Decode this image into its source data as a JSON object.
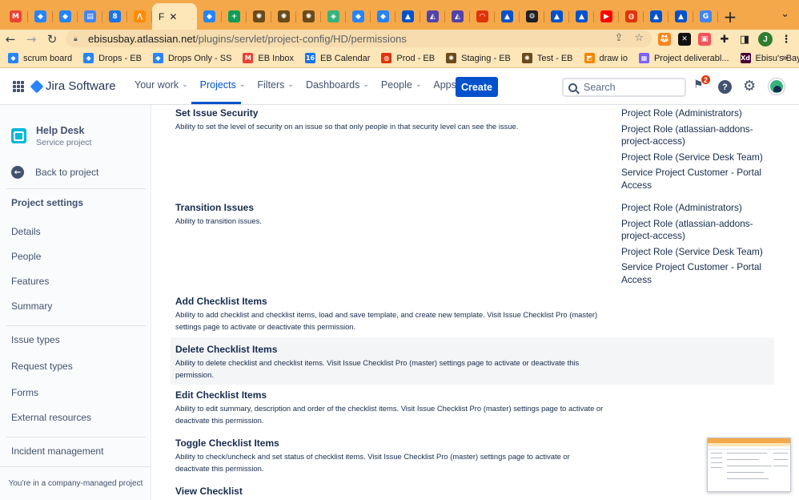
{
  "browser": {
    "tabs": [
      {
        "icon": "gmail-icon",
        "glyph": "M",
        "color": "#ea4335"
      },
      {
        "icon": "jira-icon",
        "glyph": "◆",
        "color": "#2684ff"
      },
      {
        "icon": "jira-icon",
        "glyph": "◆",
        "color": "#2684ff"
      },
      {
        "icon": "book-icon",
        "glyph": "▤",
        "color": "#4285f4"
      },
      {
        "icon": "calendar-icon",
        "glyph": "8",
        "color": "#1a73e8"
      },
      {
        "icon": "pipeline-icon",
        "glyph": "⋀",
        "color": "#ff8b00"
      }
    ],
    "active_tab": {
      "label": "F",
      "close": "✕"
    },
    "tabs_after": [
      {
        "icon": "jira-icon",
        "glyph": "◆",
        "color": "#2684ff"
      },
      {
        "icon": "sheets-icon",
        "glyph": "+",
        "color": "#0f9d58"
      },
      {
        "icon": "bug-icon",
        "glyph": "✺",
        "color": "#6b4a1a"
      },
      {
        "icon": "bug-icon",
        "glyph": "✺",
        "color": "#6b4a1a"
      },
      {
        "icon": "bug-icon",
        "glyph": "✺",
        "color": "#6b4a1a"
      },
      {
        "icon": "cube-icon",
        "glyph": "◈",
        "color": "#36b37e"
      },
      {
        "icon": "jira-icon",
        "glyph": "◆",
        "color": "#2684ff"
      },
      {
        "icon": "jira-icon",
        "glyph": "◆",
        "color": "#2684ff"
      },
      {
        "icon": "atlassian-icon",
        "glyph": "▲",
        "color": "#0052cc"
      },
      {
        "icon": "rocket-icon",
        "glyph": "◭",
        "color": "#5243aa"
      },
      {
        "icon": "rocket-icon",
        "glyph": "◭",
        "color": "#5243aa"
      },
      {
        "icon": "rainbow-icon",
        "glyph": "◠",
        "color": "#de350b"
      },
      {
        "icon": "atlassian-icon",
        "glyph": "▲",
        "color": "#0052cc"
      },
      {
        "icon": "gear-icon",
        "glyph": "⚙",
        "color": "#202124"
      },
      {
        "icon": "atlassian-icon",
        "glyph": "▲",
        "color": "#0052cc"
      },
      {
        "icon": "atlassian-icon",
        "glyph": "▲",
        "color": "#0052cc"
      },
      {
        "icon": "youtube-icon",
        "glyph": "▶",
        "color": "#ff0000"
      },
      {
        "icon": "globe-icon",
        "glyph": "◍",
        "color": "#de350b"
      },
      {
        "icon": "atlassian-icon",
        "glyph": "▲",
        "color": "#0052cc"
      },
      {
        "icon": "atlassian-icon",
        "glyph": "▲",
        "color": "#0052cc"
      },
      {
        "icon": "google-icon",
        "glyph": "G",
        "color": "#4285f4"
      }
    ],
    "new_tab": "+",
    "tab_chevron": "⌄",
    "url_host": "ebisusbay.atlassian.net",
    "url_path": "/plugins/servlet/project-config/HD/permissions",
    "profile_initial": "J",
    "bookmarks": [
      {
        "label": "scrum board",
        "icon": "jira-icon",
        "glyph": "◆",
        "color": "#2684ff"
      },
      {
        "label": "Drops - EB",
        "icon": "jira-icon",
        "glyph": "◆",
        "color": "#2684ff"
      },
      {
        "label": "Drops Only - SS",
        "icon": "jira-icon",
        "glyph": "◆",
        "color": "#2684ff"
      },
      {
        "label": "EB Inbox",
        "icon": "gmail-icon",
        "glyph": "M",
        "color": "#ea4335"
      },
      {
        "label": "EB Calendar",
        "icon": "calendar-icon",
        "glyph": "16",
        "color": "#1a73e8"
      },
      {
        "label": "Prod - EB",
        "icon": "globe-icon",
        "glyph": "◍",
        "color": "#de350b"
      },
      {
        "label": "Staging - EB",
        "icon": "bug-icon",
        "glyph": "✺",
        "color": "#6b4a1a"
      },
      {
        "label": "Test - EB",
        "icon": "bug-icon",
        "glyph": "✺",
        "color": "#6b4a1a"
      },
      {
        "label": "draw io",
        "icon": "drawio-icon",
        "glyph": "◩",
        "color": "#f08705"
      },
      {
        "label": "Project deliverabl...",
        "icon": "sheet-icon",
        "glyph": "▦",
        "color": "#7b61ff"
      },
      {
        "label": "Ebisu's Bay Offers...",
        "icon": "xd-icon",
        "glyph": "Xd",
        "color": "#470137"
      }
    ],
    "bookmarks_more": "»"
  },
  "jira": {
    "product": "Jira Software",
    "menu": [
      {
        "label": "Your work",
        "active": false
      },
      {
        "label": "Projects",
        "active": true
      },
      {
        "label": "Filters",
        "active": false
      },
      {
        "label": "Dashboards",
        "active": false
      },
      {
        "label": "People",
        "active": false
      },
      {
        "label": "Apps",
        "active": false
      }
    ],
    "create_label": "Create",
    "search_placeholder": "Search",
    "notifications_count": "2",
    "help_glyph": "?"
  },
  "sidebar": {
    "project_name": "Help Desk",
    "project_type": "Service project",
    "back_label": "Back to project",
    "heading": "Project settings",
    "items": [
      "Details",
      "People",
      "Features",
      "Summary",
      "Issue types",
      "Request types",
      "Forms",
      "External resources",
      "Incident management"
    ],
    "footer": "You're in a company-managed project"
  },
  "permissions": [
    {
      "title": "Set Issue Security",
      "description": "Ability to set the level of security on an issue so that only people in that security level can see the issue.",
      "grants": [
        "Project Role (Administrators)",
        "Project Role (atlassian-addons-project-access)",
        "Project Role (Service Desk Team)",
        "Service Project Customer - Portal Access"
      ]
    },
    {
      "title": "Transition Issues",
      "description": "Ability to transition issues.",
      "grants": [
        "Project Role (Administrators)",
        "Project Role (atlassian-addons-project-access)",
        "Project Role (Service Desk Team)",
        "Service Project Customer - Portal Access"
      ]
    },
    {
      "title": "Add Checklist Items",
      "description": "Ability to add checklist and checklist items, load and save template, and create new template. Visit Issue Checklist Pro (master) settings page to activate or deactivate this permission.",
      "grants": []
    },
    {
      "title": "Delete Checklist Items",
      "description": "Ability to delete checklist and checklist items. Visit Issue Checklist Pro (master) settings page to activate or deactivate this permission.",
      "grants": []
    },
    {
      "title": "Edit Checklist Items",
      "description": "Ability to edit summary, description and order of the checklist items. Visit Issue Checklist Pro (master) settings page to activate or deactivate this permission.",
      "grants": []
    },
    {
      "title": "Toggle Checklist Items",
      "description": "Ability to check/uncheck and set status of checklist items. Visit Issue Checklist Pro (master) settings page to activate or deactivate this permission.",
      "grants": []
    },
    {
      "title": "View Checklist",
      "description": "",
      "grants": []
    }
  ]
}
